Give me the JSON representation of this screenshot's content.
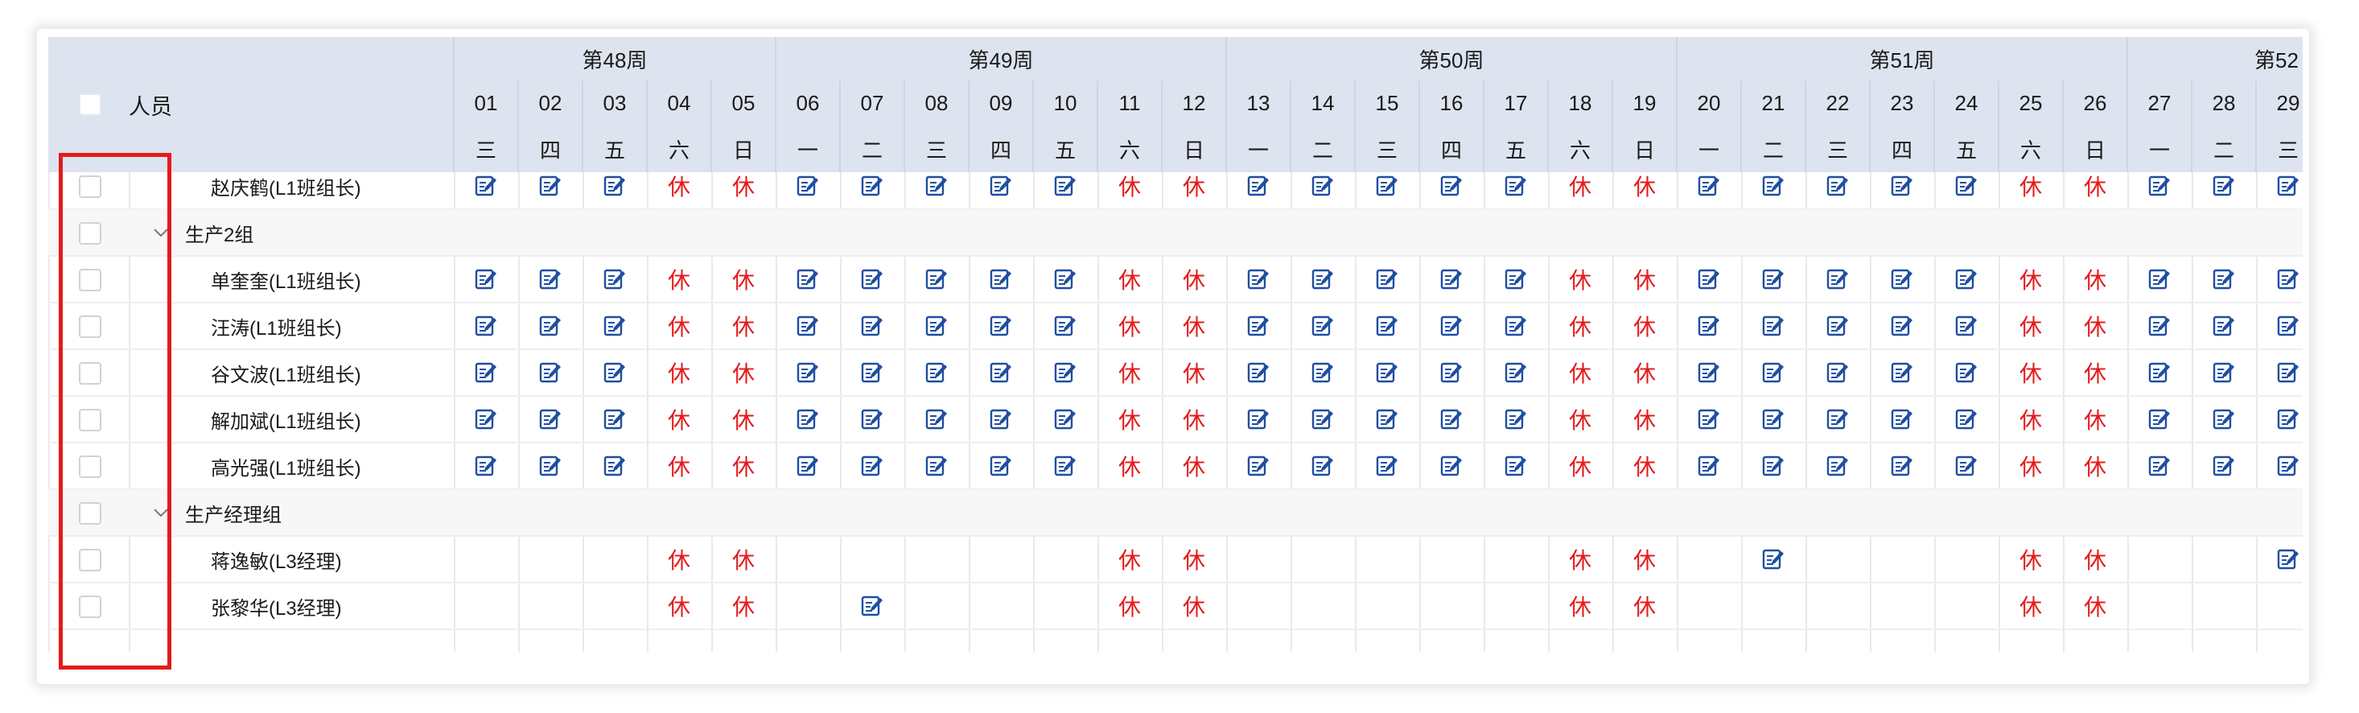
{
  "header": {
    "select_all_label": "",
    "person_col_label": "人员",
    "weeks": [
      {
        "label": "第48周",
        "span_days": 5
      },
      {
        "label": "第49周",
        "span_days": 7
      },
      {
        "label": "第50周",
        "span_days": 7
      },
      {
        "label": "第51周",
        "span_days": 7
      },
      {
        "label": "第52",
        "span_days": 3
      }
    ],
    "dates": [
      "01",
      "02",
      "03",
      "04",
      "05",
      "06",
      "07",
      "08",
      "09",
      "10",
      "11",
      "12",
      "13",
      "14",
      "15",
      "16",
      "17",
      "18",
      "19",
      "20",
      "21",
      "22",
      "23",
      "24",
      "25",
      "26",
      "27",
      "28",
      "29"
    ],
    "weekdays": [
      "三",
      "四",
      "五",
      "六",
      "日",
      "一",
      "二",
      "三",
      "四",
      "五",
      "六",
      "日",
      "一",
      "二",
      "三",
      "四",
      "五",
      "六",
      "日",
      "一",
      "二",
      "三",
      "四",
      "五",
      "六",
      "日",
      "一",
      "二",
      "三"
    ]
  },
  "cell_symbols": {
    "edit": "edit-icon",
    "rest": "休",
    "empty": ""
  },
  "rows": [
    {
      "type": "person",
      "name": "赵庆鹤(L1班组长)",
      "schedule": "EEERREEEEERREEEEERREEEEERREEE",
      "partial_top": true
    },
    {
      "type": "group",
      "name": "生产2组",
      "toggle": "chevron-down-icon"
    },
    {
      "type": "person",
      "name": "单奎奎(L1班组长)",
      "schedule": "EEERREEEEERREEEEERREEEEERREEE"
    },
    {
      "type": "person",
      "name": "汪涛(L1班组长)",
      "schedule": "EEERREEEEERREEEEERREEEEERREEE"
    },
    {
      "type": "person",
      "name": "谷文波(L1班组长)",
      "schedule": "EEERREEEEERREEEEERREEEEERREEE"
    },
    {
      "type": "person",
      "name": "解加斌(L1班组长)",
      "schedule": "EEERREEEEERREEEEERREEEEERREEE"
    },
    {
      "type": "person",
      "name": "高光强(L1班组长)",
      "schedule": "EEERREEEEERREEEEERREEEEERREEE"
    },
    {
      "type": "group",
      "name": "生产经理组",
      "toggle": "chevron-down-icon"
    },
    {
      "type": "person",
      "name": "蒋逸敏(L3经理)",
      "schedule": "...RR.....RR.....RR.E...RR..E"
    },
    {
      "type": "person",
      "name": "张黎华(L3经理)",
      "schedule": "...RR.E...RR.....RR.....RR..."
    }
  ],
  "colors": {
    "header_bg": "#dde4ef",
    "rest_text": "#e31b1b",
    "edit_icon": "#1f4ea1",
    "highlight_box": "#e31b1b",
    "group_row_bg": "#f7f7f7"
  }
}
